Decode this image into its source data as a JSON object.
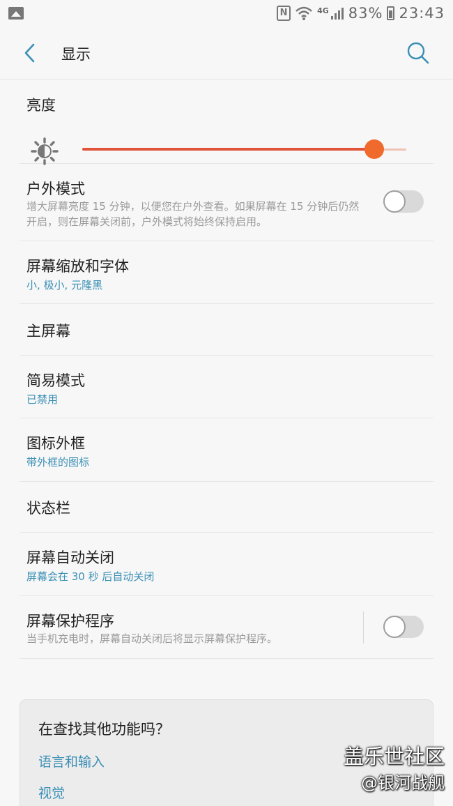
{
  "status_bar": {
    "battery": "83%",
    "time": "23:43",
    "network": "4G",
    "nfc": "N",
    "icons": [
      "gallery-icon",
      "nfc-icon",
      "wifi-icon",
      "signal-icon",
      "battery-icon"
    ]
  },
  "header": {
    "title": "显示",
    "back_icon": "chevron-left-icon",
    "search_icon": "search-icon"
  },
  "accent_colors": {
    "slider": "#e2543a",
    "link": "#3a8fb5"
  },
  "brightness": {
    "title": "亮度",
    "level": 0.9
  },
  "settings": [
    {
      "title": "户外模式",
      "subtitle": "增大屏幕亮度 15 分钟，以便您在户外查看。如果屏幕在 15 分钟后仍然开启，则在屏幕关闭前，户外模式将始终保持启用。",
      "toggle": false
    },
    {
      "title": "屏幕缩放和字体",
      "value": "小, 极小, 元隆黑"
    },
    {
      "title": "主屏幕"
    },
    {
      "title": "简易模式",
      "value": "已禁用"
    },
    {
      "title": "图标外框",
      "value": "带外框的图标"
    },
    {
      "title": "状态栏"
    },
    {
      "title": "屏幕自动关闭",
      "value": "屏幕会在 30 秒 后自动关闭"
    },
    {
      "title": "屏幕保护程序",
      "subtitle": "当手机充电时，屏幕自动关闭后将显示屏幕保护程序。",
      "toggle": false
    }
  ],
  "suggestions": {
    "title": "在查找其他功能吗？",
    "links": [
      "语言和输入",
      "视觉"
    ]
  },
  "watermark": {
    "line1": "盖乐世社区",
    "line2": "@银河战舰"
  }
}
